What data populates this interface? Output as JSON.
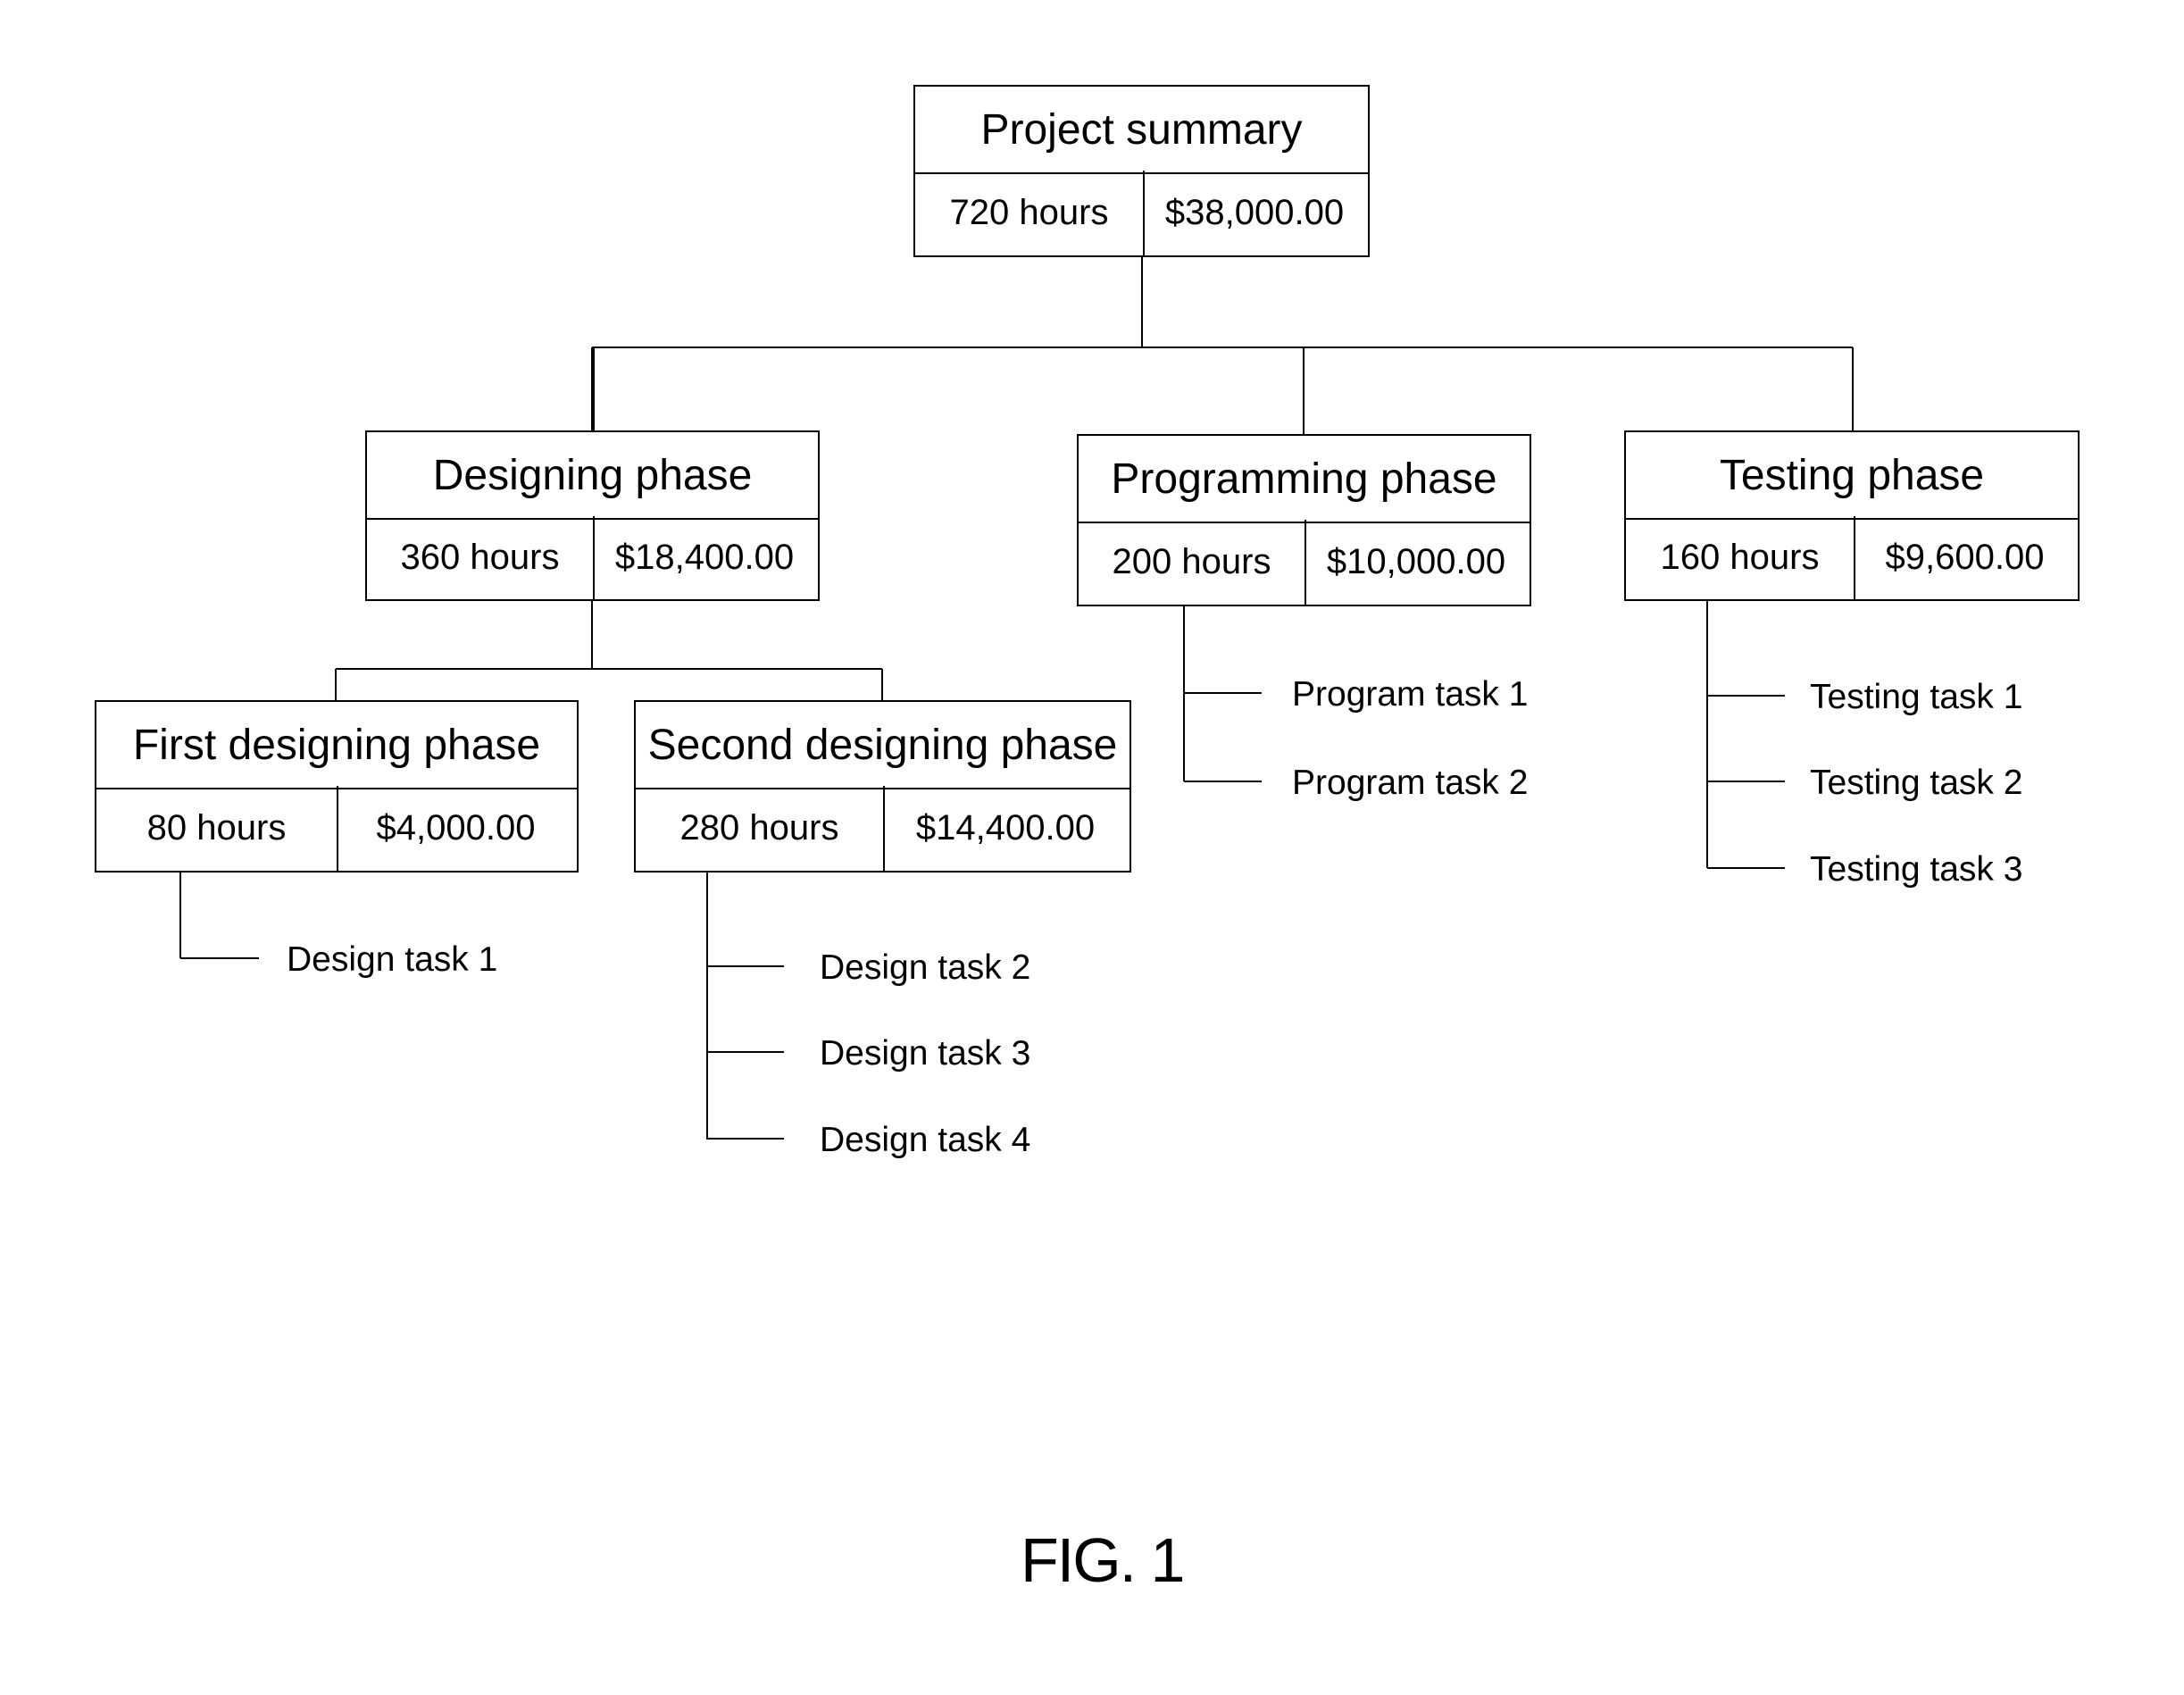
{
  "figure_label": "FIG. 1",
  "root": {
    "title": "Project summary",
    "hours": "720 hours",
    "cost": "$38,000.00"
  },
  "phases": [
    {
      "title": "Designing phase",
      "hours": "360 hours",
      "cost": "$18,400.00"
    },
    {
      "title": "Programming phase",
      "hours": "200 hours",
      "cost": "$10,000.00",
      "tasks": [
        "Program task 1",
        "Program task 2"
      ]
    },
    {
      "title": "Testing phase",
      "hours": "160 hours",
      "cost": "$9,600.00",
      "tasks": [
        "Testing task 1",
        "Testing task 2",
        "Testing task 3"
      ]
    }
  ],
  "subphases": [
    {
      "title": "First designing phase",
      "hours": "80 hours",
      "cost": "$4,000.00",
      "tasks": [
        "Design task 1"
      ]
    },
    {
      "title": "Second designing phase",
      "hours": "280 hours",
      "cost": "$14,400.00",
      "tasks": [
        "Design task 2",
        "Design task 3",
        "Design task 4"
      ]
    }
  ]
}
